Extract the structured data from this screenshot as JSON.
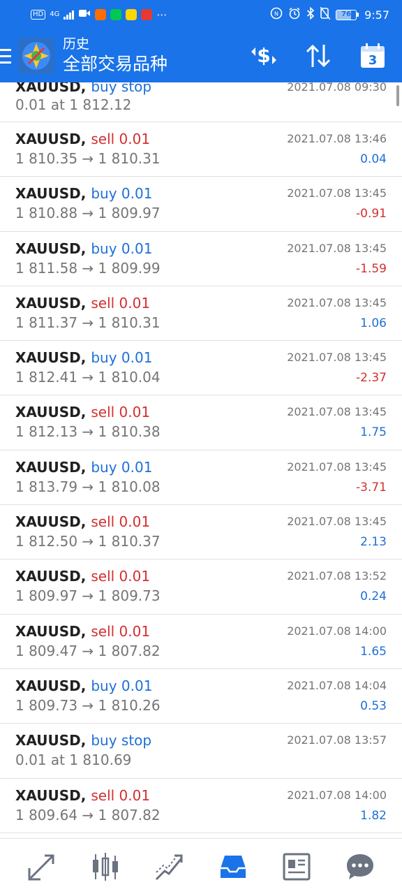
{
  "status_bar": {
    "hd": "HD",
    "network": "4G",
    "time": "9:57",
    "battery": "76",
    "battery_level": 0.76,
    "app_icon_colors": [
      "#ff6d00",
      "#00c853",
      "#ffd600",
      "#e53935"
    ]
  },
  "header": {
    "title": "历史",
    "subtitle": "全部交易品种",
    "calendar_day": "3",
    "icons": [
      "menu-icon",
      "app-logo-icon",
      "currency-filter-icon",
      "sort-icon",
      "calendar-icon"
    ]
  },
  "colors": {
    "accent": "#1a73e8",
    "sell": "#d32f2f",
    "buy": "#1e6fd9",
    "negative": "#d32f2f",
    "positive": "#1e6fd9"
  },
  "orders": [
    {
      "symbol": "XAUUSD,",
      "side": "buy stop",
      "side_type": "buy",
      "prices": "0.01 at 1 812.12",
      "time": "2021.07.08 09:30",
      "profit": "",
      "profit_sign": ""
    },
    {
      "symbol": "XAUUSD,",
      "side": "sell 0.01",
      "side_type": "sell",
      "prices": "1 810.35 → 1 810.31",
      "time": "2021.07.08 13:46",
      "profit": "0.04",
      "profit_sign": "pos"
    },
    {
      "symbol": "XAUUSD,",
      "side": "buy 0.01",
      "side_type": "buy",
      "prices": "1 810.88 → 1 809.97",
      "time": "2021.07.08 13:45",
      "profit": "-0.91",
      "profit_sign": "neg"
    },
    {
      "symbol": "XAUUSD,",
      "side": "buy 0.01",
      "side_type": "buy",
      "prices": "1 811.58 → 1 809.99",
      "time": "2021.07.08 13:45",
      "profit": "-1.59",
      "profit_sign": "neg"
    },
    {
      "symbol": "XAUUSD,",
      "side": "sell 0.01",
      "side_type": "sell",
      "prices": "1 811.37 → 1 810.31",
      "time": "2021.07.08 13:45",
      "profit": "1.06",
      "profit_sign": "pos"
    },
    {
      "symbol": "XAUUSD,",
      "side": "buy 0.01",
      "side_type": "buy",
      "prices": "1 812.41 → 1 810.04",
      "time": "2021.07.08 13:45",
      "profit": "-2.37",
      "profit_sign": "neg"
    },
    {
      "symbol": "XAUUSD,",
      "side": "sell 0.01",
      "side_type": "sell",
      "prices": "1 812.13 → 1 810.38",
      "time": "2021.07.08 13:45",
      "profit": "1.75",
      "profit_sign": "pos"
    },
    {
      "symbol": "XAUUSD,",
      "side": "buy 0.01",
      "side_type": "buy",
      "prices": "1 813.79 → 1 810.08",
      "time": "2021.07.08 13:45",
      "profit": "-3.71",
      "profit_sign": "neg"
    },
    {
      "symbol": "XAUUSD,",
      "side": "sell 0.01",
      "side_type": "sell",
      "prices": "1 812.50 → 1 810.37",
      "time": "2021.07.08 13:45",
      "profit": "2.13",
      "profit_sign": "pos"
    },
    {
      "symbol": "XAUUSD,",
      "side": "sell 0.01",
      "side_type": "sell",
      "prices": "1 809.97 → 1 809.73",
      "time": "2021.07.08 13:52",
      "profit": "0.24",
      "profit_sign": "pos"
    },
    {
      "symbol": "XAUUSD,",
      "side": "sell 0.01",
      "side_type": "sell",
      "prices": "1 809.47 → 1 807.82",
      "time": "2021.07.08 14:00",
      "profit": "1.65",
      "profit_sign": "pos"
    },
    {
      "symbol": "XAUUSD,",
      "side": "buy 0.01",
      "side_type": "buy",
      "prices": "1 809.73 → 1 810.26",
      "time": "2021.07.08 14:04",
      "profit": "0.53",
      "profit_sign": "pos"
    },
    {
      "symbol": "XAUUSD,",
      "side": "buy stop",
      "side_type": "buy",
      "prices": "0.01 at 1 810.69",
      "time": "2021.07.08 13:57",
      "profit": "",
      "profit_sign": ""
    },
    {
      "symbol": "XAUUSD,",
      "side": "sell 0.01",
      "side_type": "sell",
      "prices": "1 809.64 → 1 807.82",
      "time": "2021.07.08 14:00",
      "profit": "1.82",
      "profit_sign": "pos"
    }
  ],
  "bottom_nav": {
    "items": [
      "quotes-icon",
      "chart-icon",
      "trade-icon",
      "history-icon",
      "news-icon",
      "chat-icon"
    ],
    "active": "history-icon"
  }
}
